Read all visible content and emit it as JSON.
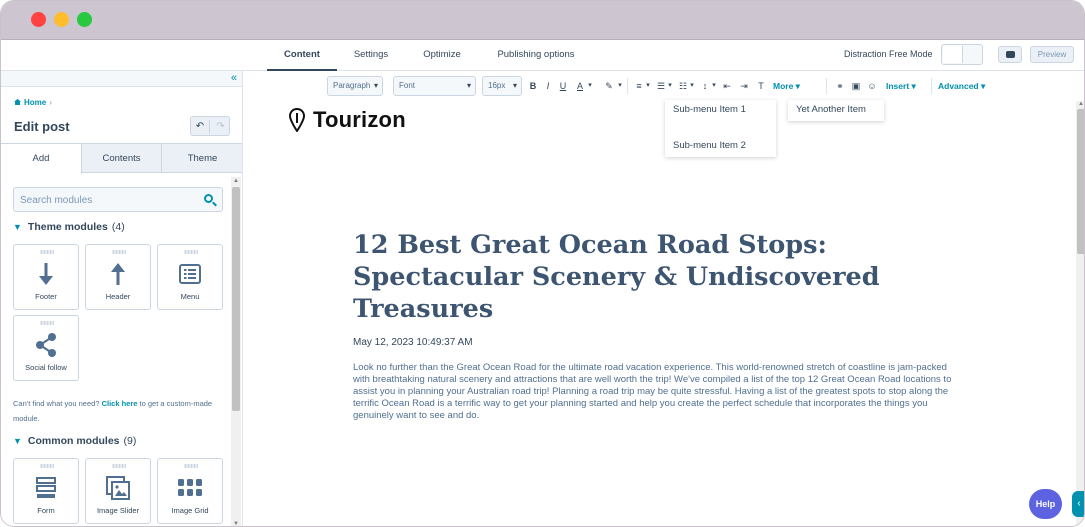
{
  "window": {
    "buttons": [
      "close",
      "minimize",
      "maximize"
    ]
  },
  "topnav": {
    "tabs": [
      {
        "label": "Content",
        "active": true
      },
      {
        "label": "Settings",
        "active": false
      },
      {
        "label": "Optimize",
        "active": false
      },
      {
        "label": "Publishing options",
        "active": false
      }
    ],
    "distraction_free_label": "Distraction Free Mode",
    "comment_icon": "comment-icon",
    "preview_label": "Preview"
  },
  "sidebar": {
    "collapse_icon": "double-chevron-left-icon",
    "breadcrumb": "Home",
    "title": "Edit post",
    "undo_icon": "undo-icon",
    "redo_icon": "redo-icon",
    "tabs": [
      {
        "label": "Add",
        "active": true
      },
      {
        "label": "Contents",
        "active": false
      },
      {
        "label": "Theme",
        "active": false
      }
    ],
    "search_placeholder": "Search modules",
    "theme_modules": {
      "title": "Theme modules",
      "count": "(4)",
      "items": [
        {
          "label": "Footer",
          "icon": "arrow-down-icon"
        },
        {
          "label": "Header",
          "icon": "arrow-up-icon"
        },
        {
          "label": "Menu",
          "icon": "menu-list-icon"
        },
        {
          "label": "Social follow",
          "icon": "share-icon"
        }
      ]
    },
    "custom_note": {
      "before": "Can't find what you need?",
      "link": "Click here",
      "after": "to get a custom-made module."
    },
    "common_modules": {
      "title": "Common modules",
      "count": "(9)",
      "items": [
        {
          "label": "Form",
          "icon": "form-icon"
        },
        {
          "label": "Image Slider",
          "icon": "image-slider-icon"
        },
        {
          "label": "Image Grid",
          "icon": "image-grid-icon"
        }
      ]
    }
  },
  "toolbar": {
    "paragraph": "Paragraph",
    "font": "Font",
    "size": "16px",
    "bold": "B",
    "italic": "I",
    "underline": "U",
    "text_color": "A",
    "more": "More",
    "insert": "Insert",
    "advanced": "Advanced"
  },
  "page": {
    "logo_text": "Tourizon",
    "menu_dropdown": [
      "Sub-menu Item 1",
      "Sub-menu Item 2"
    ],
    "menu_dropdown_2": [
      "Yet Another Item"
    ],
    "title": "12 Best Great Ocean Road Stops: Spectacular Scenery & Undiscovered Treasures",
    "date": "May 12, 2023 10:49:37 AM",
    "body": "Look no further than the Great Ocean Road for the ultimate road vacation experience. This world-renowned stretch of coastline is jam-packed with breathtaking natural scenery and attractions that are well worth the trip! We've compiled a list of the top 12 Great Ocean Road locations to assist you in planning your Australian road trip! Planning a road trip may be quite stressful. Having a list of the greatest spots to stop along the terrific Ocean Road is a terrific way to get your planning started and help you create the perfect schedule that incorporates the things you genuinely want to see and do."
  },
  "help_label": "Help",
  "colors": {
    "accent": "#0091ae",
    "text": "#33475b",
    "title": "#3d5570",
    "help": "#5c62e0"
  }
}
